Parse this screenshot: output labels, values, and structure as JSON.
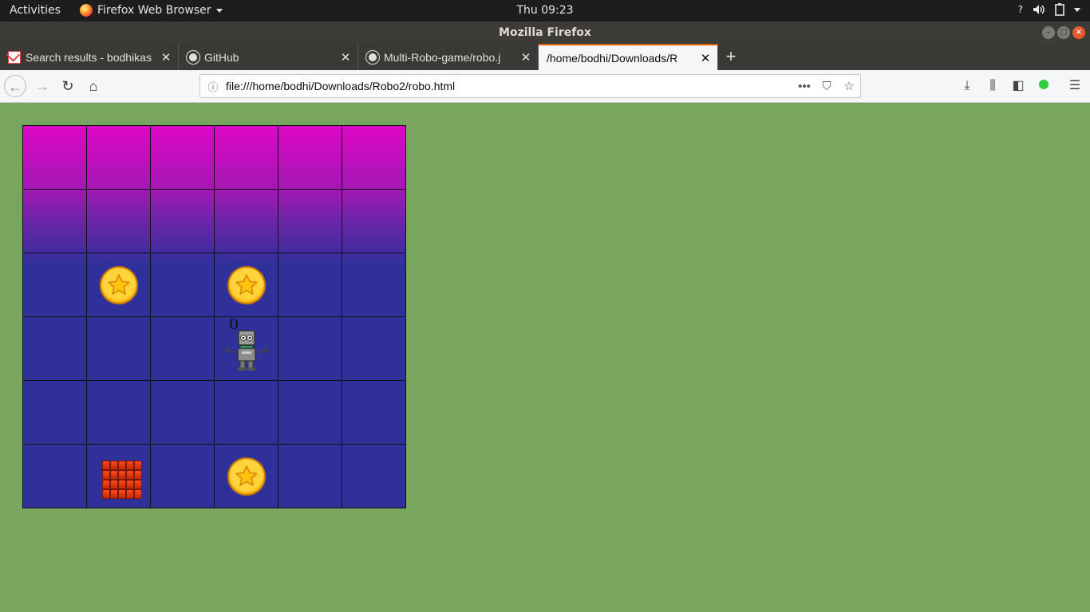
{
  "topbar": {
    "activities": "Activities",
    "app_name": "Firefox Web Browser",
    "clock": "Thu 09:23",
    "tray_icons": [
      "help-icon",
      "volume-icon",
      "battery-icon",
      "system-menu-caret-icon"
    ]
  },
  "window": {
    "title": "Mozilla Firefox"
  },
  "tabs": [
    {
      "label": "Search results - bodhikas",
      "favicon": "gmail-icon",
      "active": false
    },
    {
      "label": "GitHub",
      "favicon": "github-icon",
      "active": false
    },
    {
      "label": "Multi-Robo-game/robo.j",
      "favicon": "github-icon",
      "active": false
    },
    {
      "label": "/home/bodhi/Downloads/R",
      "favicon": "none",
      "active": true
    }
  ],
  "navbar": {
    "url": "file:///home/bodhi/Downloads/Robo2/robo.html",
    "page_actions": "•••"
  },
  "game": {
    "rows": 6,
    "cols": 6,
    "score": "0",
    "colors": {
      "top": "#dd07c5",
      "base": "#30309b",
      "background": "#79a65f"
    },
    "items": [
      {
        "type": "coin",
        "row": 2,
        "col": 1
      },
      {
        "type": "coin",
        "row": 2,
        "col": 3
      },
      {
        "type": "robot",
        "row": 3,
        "col": 3
      },
      {
        "type": "brick-wall",
        "row": 5,
        "col": 1
      },
      {
        "type": "coin",
        "row": 5,
        "col": 3
      }
    ]
  }
}
